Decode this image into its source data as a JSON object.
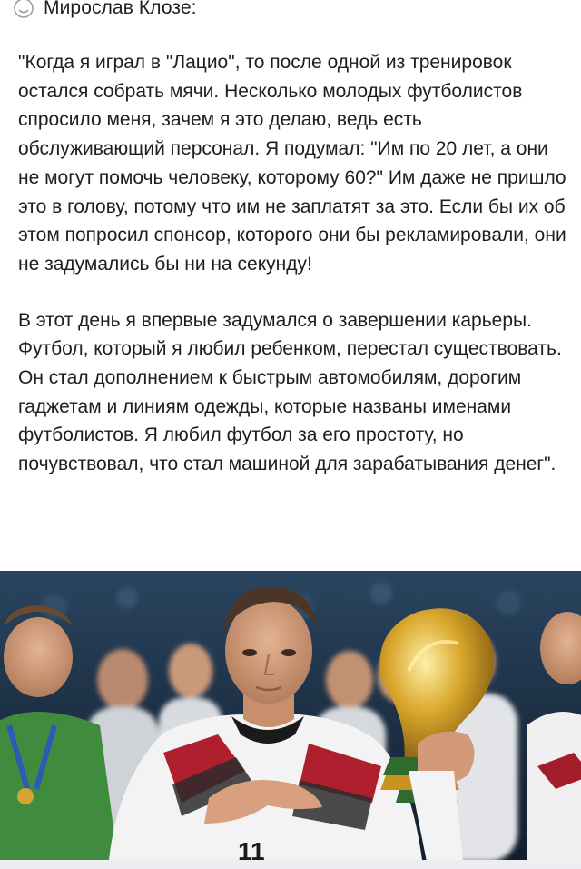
{
  "post": {
    "author": "Мирослав Клозе:",
    "author_icon": "emoji-icon",
    "paragraphs": [
      "\"Когда я играл в \"Лацио\", то после одной из тренировок остался собрать мячи. Несколько молодых футболистов спросило меня, зачем я это делаю, ведь есть обслуживающий персонал. Я подумал: \"Им по 20 лет, а они не могут помочь человеку, которому 60?\" Им даже не пришло это в голову, потому что им не заплатят за это. Если бы их об этом попросил спонсор, которого они бы рекламировали, они не задумались бы ни на секунду!",
      "В этот день я впервые задумался о завершении карьеры. Футбол, который я любил ребенком, перестал существовать. Он стал дополнением к быстрым автомобилям, дорогим гаджетам и линиям одежды, которые названы именами футболистов. Я любил футбол за его простоту, но почувствовал, что стал машиной для зарабатывания денег\"."
    ]
  },
  "photo": {
    "jersey_number": "11",
    "colors": {
      "background": "#1f3348",
      "shirt": "#f2f2f2",
      "shirt_accent": "#a31d2b",
      "trophy_gold": "#c8941f",
      "trophy_green": "#2f6b2c",
      "keeper_green": "#3a8a3c"
    }
  }
}
